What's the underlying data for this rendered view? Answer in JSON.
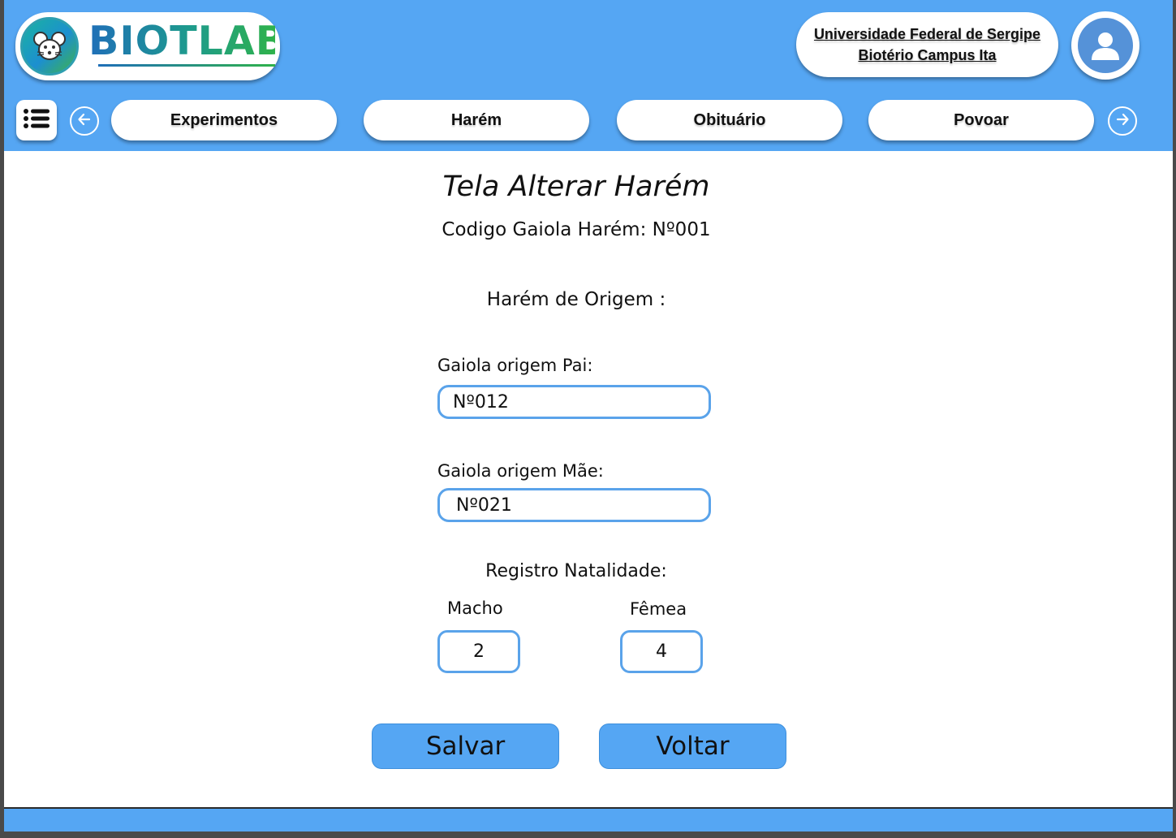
{
  "header": {
    "logo_text": "BIOTLAB",
    "institution": {
      "line1": "Universidade Federal de Sergipe",
      "line2": "Biotério Campus Ita"
    }
  },
  "nav": {
    "tabs": [
      {
        "label": "Experimentos"
      },
      {
        "label": "Harém"
      },
      {
        "label": "Obituário"
      },
      {
        "label": "Povoar"
      }
    ]
  },
  "form": {
    "title": "Tela Alterar Harém",
    "cage_code": "Codigo Gaiola Harém: Nº001",
    "origin_heading": "Harém de Origem :",
    "father_label": "Gaiola origem Pai:",
    "father_value": "Nº012",
    "mother_label": "Gaiola origem Mãe:",
    "mother_value": "Nº021",
    "birth_heading": "Registro Natalidade:",
    "male_label": "Macho",
    "male_value": "2",
    "female_label": "Fêmea",
    "female_value": "4",
    "save_label": "Salvar",
    "back_label": "Voltar"
  },
  "colors": {
    "primary": "#55a6f3",
    "field_border": "#5aa3ea",
    "avatar": "#5592d8"
  },
  "icons": {
    "logo": "mouse-icon",
    "menu": "list-icon",
    "prev": "arrow-left-icon",
    "next": "arrow-right-icon",
    "avatar": "user-icon"
  }
}
